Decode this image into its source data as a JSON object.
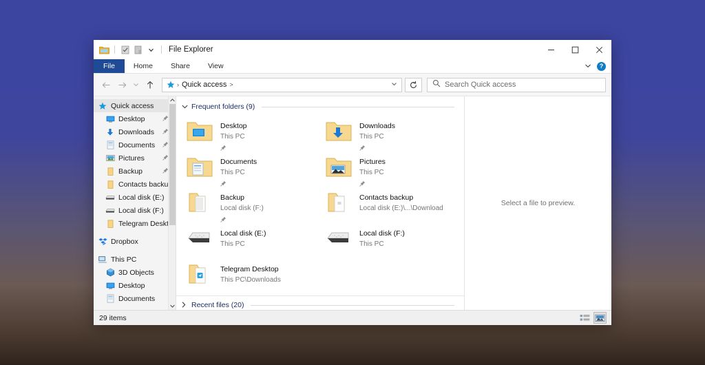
{
  "window": {
    "title": "File Explorer",
    "quick_access_toolbar": [
      {
        "name": "folder-icon",
        "label": "File Explorer"
      },
      {
        "name": "properties-icon",
        "label": "Properties"
      },
      {
        "name": "new-folder-icon",
        "label": "New folder"
      },
      {
        "name": "customize-chevron-icon",
        "label": "Customize Quick Access Toolbar"
      }
    ],
    "controls": {
      "minimize": "Minimize",
      "maximize": "Maximize",
      "close": "Close"
    }
  },
  "ribbon": {
    "tabs": [
      {
        "label": "File",
        "active": true
      },
      {
        "label": "Home",
        "active": false
      },
      {
        "label": "Share",
        "active": false
      },
      {
        "label": "View",
        "active": false
      }
    ],
    "expand_label": "Expand the Ribbon",
    "help_label": "?"
  },
  "nav_toolbar": {
    "back": "Back",
    "forward": "Forward",
    "recent": "Recent locations",
    "up": "Up",
    "breadcrumb": {
      "root_icon": "quick-access-star-icon",
      "items": [
        "Quick access"
      ],
      "trailing_separator": ">"
    },
    "address_dropdown": "Previous locations",
    "refresh": "Refresh",
    "search": {
      "placeholder": "Search Quick access",
      "value": ""
    }
  },
  "sidebar": {
    "items": [
      {
        "label": "Quick access",
        "icon": "quick-access-star-icon",
        "indent": 0,
        "selected": true,
        "pinned": false
      },
      {
        "label": "Desktop",
        "icon": "desktop-icon",
        "indent": 1,
        "selected": false,
        "pinned": true
      },
      {
        "label": "Downloads",
        "icon": "downloads-arrow-icon",
        "indent": 1,
        "selected": false,
        "pinned": true
      },
      {
        "label": "Documents",
        "icon": "documents-icon",
        "indent": 1,
        "selected": false,
        "pinned": true
      },
      {
        "label": "Pictures",
        "icon": "pictures-icon",
        "indent": 1,
        "selected": false,
        "pinned": true
      },
      {
        "label": "Backup",
        "icon": "folder-icon",
        "indent": 1,
        "selected": false,
        "pinned": true
      },
      {
        "label": "Contacts backup",
        "icon": "folder-icon",
        "indent": 1,
        "selected": false,
        "pinned": false
      },
      {
        "label": "Local disk (E:)",
        "icon": "drive-icon",
        "indent": 1,
        "selected": false,
        "pinned": false
      },
      {
        "label": "Local disk (F:)",
        "icon": "drive-icon",
        "indent": 1,
        "selected": false,
        "pinned": false
      },
      {
        "label": "Telegram Desktop",
        "icon": "folder-icon",
        "indent": 1,
        "selected": false,
        "pinned": false
      },
      {
        "label": "Dropbox",
        "icon": "dropbox-icon",
        "indent": 0,
        "selected": false,
        "pinned": false,
        "gap": true
      },
      {
        "label": "This PC",
        "icon": "this-pc-icon",
        "indent": 0,
        "selected": false,
        "pinned": false,
        "gap": true
      },
      {
        "label": "3D Objects",
        "icon": "3d-objects-icon",
        "indent": 1,
        "selected": false,
        "pinned": false
      },
      {
        "label": "Desktop",
        "icon": "desktop-icon",
        "indent": 1,
        "selected": false,
        "pinned": false
      },
      {
        "label": "Documents",
        "icon": "documents-icon",
        "indent": 1,
        "selected": false,
        "pinned": false
      }
    ]
  },
  "content": {
    "frequent_group": {
      "label": "Frequent folders (9)",
      "expanded": true,
      "chevron": "chevron-down-icon"
    },
    "tiles": [
      {
        "name": "Desktop",
        "sub": "This PC",
        "icon": "folder-desktop-icon",
        "pinned": true
      },
      {
        "name": "Downloads",
        "sub": "This PC",
        "icon": "folder-downloads-icon",
        "pinned": true
      },
      {
        "name": "Documents",
        "sub": "This PC",
        "icon": "folder-documents-icon",
        "pinned": true
      },
      {
        "name": "Pictures",
        "sub": "This PC",
        "icon": "folder-pictures-icon",
        "pinned": true
      },
      {
        "name": "Backup",
        "sub": "Local disk (F:)",
        "icon": "folder-generic-icon",
        "pinned": true
      },
      {
        "name": "Contacts backup",
        "sub": "Local disk (E:)\\...\\Download",
        "icon": "folder-generic-icon",
        "pinned": false
      },
      {
        "name": "Local disk (E:)",
        "sub": "This PC",
        "icon": "drive-icon",
        "pinned": false
      },
      {
        "name": "Local disk (F:)",
        "sub": "This PC",
        "icon": "drive-icon",
        "pinned": false
      },
      {
        "name": "Telegram Desktop",
        "sub": "This PC\\Downloads",
        "icon": "folder-telegram-icon",
        "pinned": false
      }
    ],
    "recent_group": {
      "label": "Recent files (20)",
      "expanded": false,
      "chevron": "chevron-right-icon"
    }
  },
  "preview": {
    "message": "Select a file to preview."
  },
  "statusbar": {
    "items_count": "29 items",
    "views": [
      {
        "name": "details-view-icon",
        "active": false
      },
      {
        "name": "large-icons-view-icon",
        "active": true
      }
    ]
  },
  "colors": {
    "file_tab": "#1f4b96",
    "accent_blue": "#0f7cc6",
    "group_header_text": "#1a2a5e",
    "folder_yellow": "#f5cf78",
    "desktop_gradient_top": "#3c45a0",
    "desktop_gradient_bottom": "#2e231c"
  }
}
